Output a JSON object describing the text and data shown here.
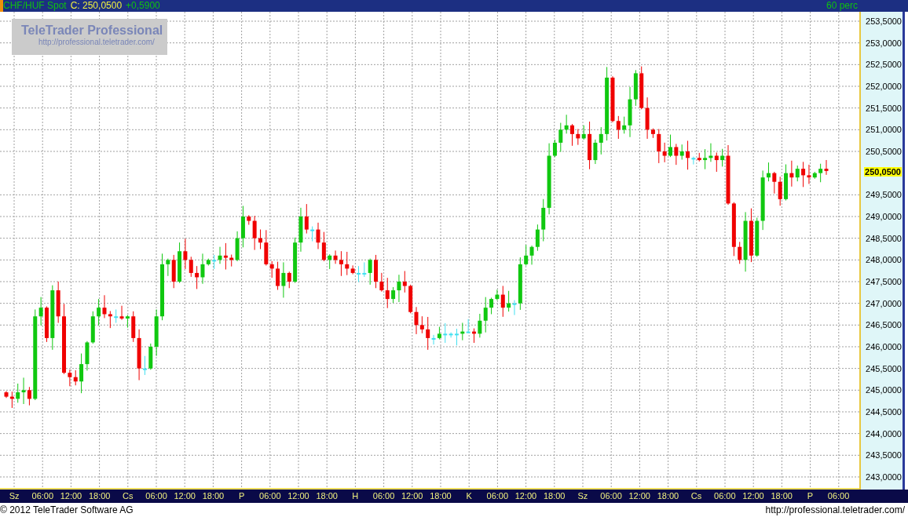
{
  "title_bar": {
    "symbol": "CHF/HUF Spot",
    "close_label": "C: 250,0500",
    "change": "+0,5900",
    "interval": "60 perc"
  },
  "logo": {
    "name": "TeleTrader Professional",
    "url": "http://professional.teletrader.com/"
  },
  "price_axis": {
    "ticks": [
      "253,5000",
      "253,0000",
      "252,5000",
      "252,0000",
      "251,5000",
      "251,0000",
      "250,5000",
      "249,5000",
      "249,0000",
      "248,5000",
      "248,0000",
      "247,5000",
      "247,0000",
      "246,5000",
      "246,0000",
      "245,5000",
      "245,0000",
      "244,5000",
      "244,0000",
      "243,5000",
      "243,0000"
    ],
    "current_price": "250,0500"
  },
  "time_axis": {
    "labels": [
      "Sz",
      "06:00",
      "12:00",
      "18:00",
      "Cs",
      "06:00",
      "12:00",
      "18:00",
      "P",
      "06:00",
      "12:00",
      "18:00",
      "H",
      "06:00",
      "12:00",
      "18:00",
      "K",
      "06:00",
      "12:00",
      "18:00",
      "Sz",
      "06:00",
      "12:00",
      "18:00",
      "Cs",
      "06:00",
      "12:00",
      "18:00",
      "P",
      "06:00"
    ]
  },
  "footer": {
    "copyright": "© 2012 TeleTrader Software AG",
    "url": "http://professional.teletrader.com/"
  }
}
